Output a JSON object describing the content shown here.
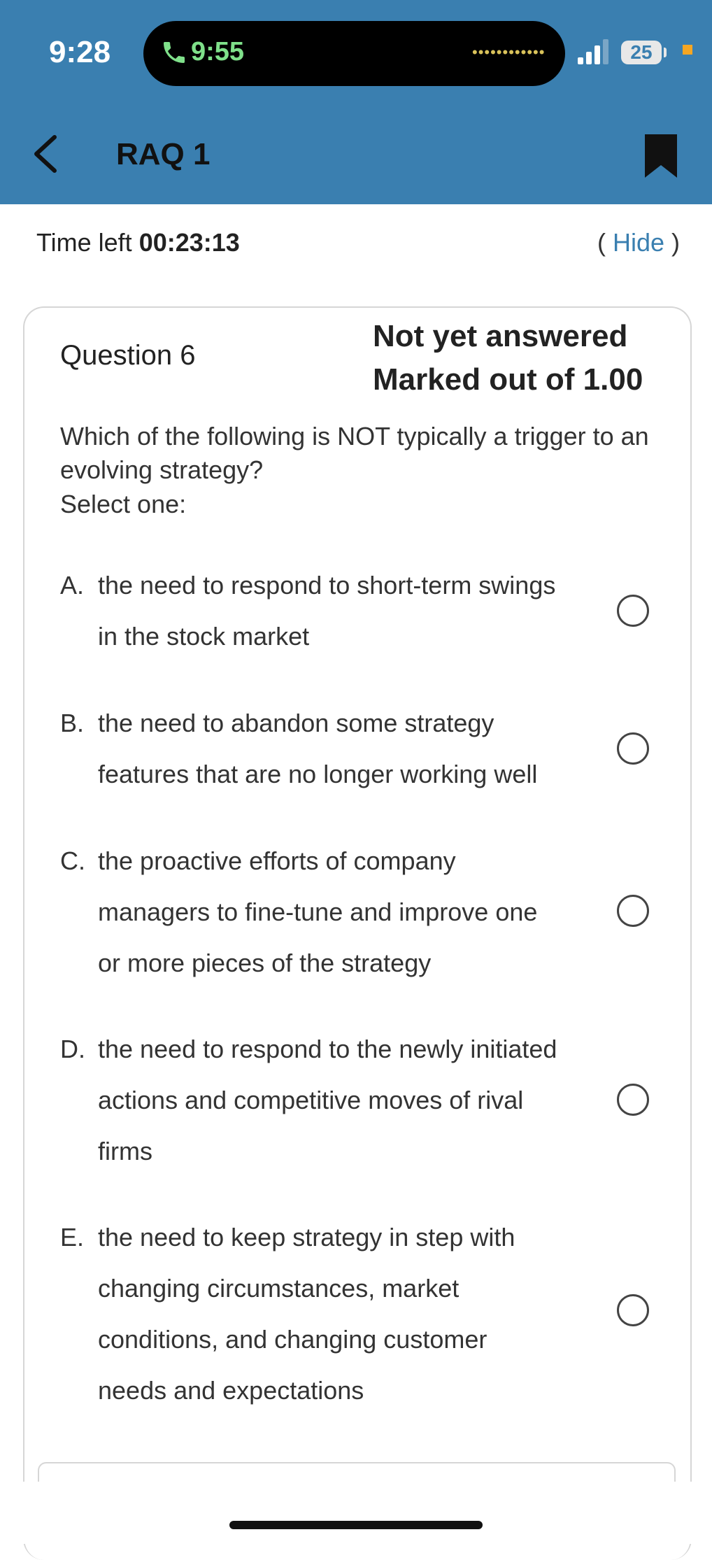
{
  "status_bar": {
    "clock": "9:28",
    "call_time": "9:55",
    "waveform": "••••••••••••",
    "battery": "25"
  },
  "header": {
    "title": "RAQ 1"
  },
  "timer": {
    "label": "Time left ",
    "value": "00:23:13",
    "hide_open": "( ",
    "hide_label": "Hide",
    "hide_close": " )"
  },
  "question": {
    "label": "Question 6",
    "status_line1": "Not yet answered",
    "status_line2": "Marked out of 1.00",
    "text": "Which of the following is NOT typically a trigger to an evolving strategy?",
    "instruction": "Select one:",
    "options": [
      {
        "letter": "A.",
        "text": "the need to respond to short-term swings in the stock market"
      },
      {
        "letter": "B.",
        "text": "the need to abandon some strategy features that are no longer working well"
      },
      {
        "letter": "C.",
        "text": "the proactive efforts of company managers to fine-tune and improve one or more pieces of the strategy"
      },
      {
        "letter": "D.",
        "text": "the need to respond to the newly initiated actions and competitive moves of rival firms"
      },
      {
        "letter": "E.",
        "text": "the need to keep strategy in step with changing circumstances, market conditions, and changing customer needs and expectations"
      }
    ]
  },
  "colors": {
    "header_bg": "#3a7fb0",
    "link": "#3a7fb0",
    "call_green": "#7fe08a"
  }
}
